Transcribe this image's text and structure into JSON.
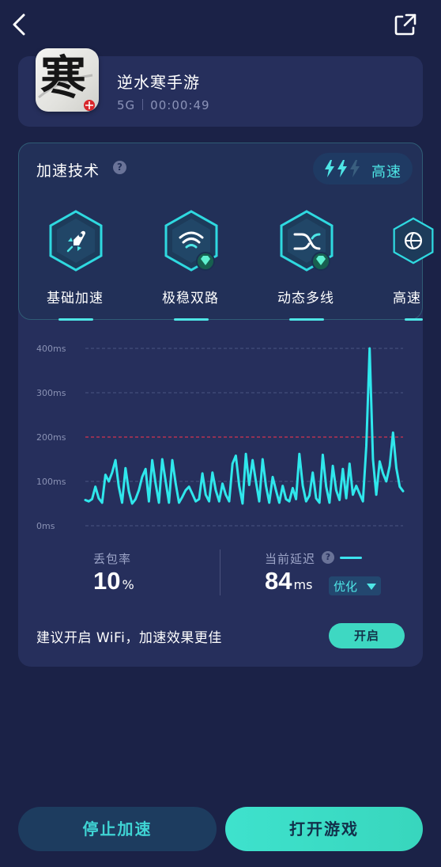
{
  "game": {
    "title": "逆水寒手游",
    "network": "5G",
    "elapsed": "00:00:49",
    "icon_char": "寒"
  },
  "tech": {
    "title": "加速技术",
    "help": "?",
    "speed_level": "高速",
    "bolts_active": 2,
    "bolts_total": 3,
    "items": [
      {
        "label": "基础加速",
        "icon": "rocket-icon",
        "premium": false
      },
      {
        "label": "极稳双路",
        "icon": "wifi-dual-icon",
        "premium": true
      },
      {
        "label": "动态多线",
        "icon": "multi-line-icon",
        "premium": true
      },
      {
        "label": "高速",
        "icon": "globe-icon",
        "premium": false
      }
    ]
  },
  "chart_data": {
    "type": "line",
    "yticks": [
      "0ms",
      "100ms",
      "200ms",
      "300ms",
      "400ms"
    ],
    "ylim": [
      0,
      400
    ],
    "threshold": 200,
    "series": [
      {
        "values": [
          58,
          55,
          60,
          88,
          62,
          52,
          115,
          100,
          120,
          148,
          88,
          52,
          130,
          78,
          50,
          60,
          80,
          110,
          128,
          55,
          148,
          95,
          52,
          150,
          100,
          52,
          148,
          95,
          52,
          65,
          80,
          88,
          72,
          55,
          60,
          118,
          70,
          55,
          120,
          80,
          55,
          95,
          70,
          55,
          140,
          158,
          90,
          50,
          162,
          92,
          148,
          100,
          55,
          150,
          90,
          52,
          110,
          80,
          52,
          90,
          60,
          55,
          85,
          60,
          162,
          90,
          55,
          68,
          120,
          62,
          52,
          160,
          88,
          52,
          135,
          80,
          58,
          128,
          62,
          140,
          70,
          90,
          72,
          55,
          180,
          400,
          150,
          70,
          145,
          118,
          100,
          135,
          210,
          130,
          88,
          78
        ]
      }
    ],
    "colors": {
      "line": "#2fe7ec",
      "threshold": "#d4334f",
      "grid": "#4b5482"
    }
  },
  "stats": {
    "loss_label": "丢包率",
    "loss_value": "10",
    "loss_unit": "%",
    "latency_label": "当前延迟",
    "latency_value": "84",
    "latency_unit": "ms",
    "optimize_label": "优化"
  },
  "wifi_tip": {
    "text": "建议开启 WiFi，加速效果更佳",
    "button": "开启"
  },
  "actions": {
    "stop": "停止加速",
    "open": "打开游戏"
  },
  "colors": {
    "accent": "#4ee6e6",
    "background": "#1b2247",
    "card": "#262f5c",
    "primary_button": "#3ee2cd"
  }
}
